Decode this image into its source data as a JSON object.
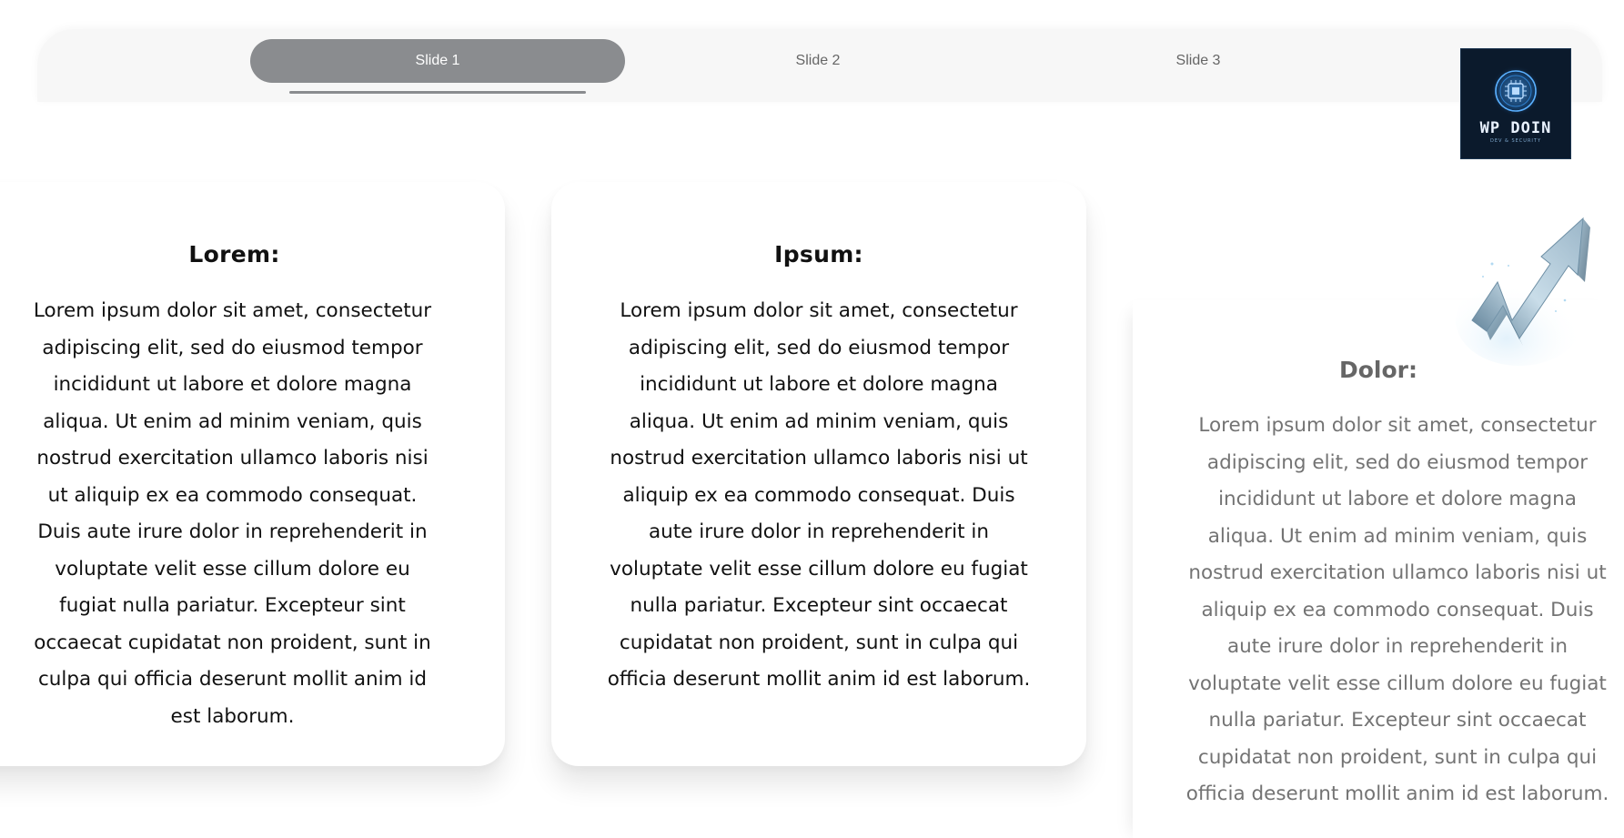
{
  "tabs": [
    {
      "label": "Slide 1",
      "active": true
    },
    {
      "label": "Slide 2",
      "active": false
    },
    {
      "label": "Slide 3",
      "active": false
    }
  ],
  "logo": {
    "text": "WP DOIN",
    "sub": "DEV & SECURITY"
  },
  "cards": [
    {
      "title": "Lorem:",
      "body": "Lorem ipsum dolor sit amet, consectetur adipiscing elit, sed do eiusmod tempor incididunt ut labore et dolore magna aliqua. Ut enim ad minim veniam, quis nostrud exercitation ullamco laboris nisi ut aliquip ex ea commodo consequat. Duis aute irure dolor in reprehenderit in voluptate velit esse cillum dolore eu fugiat nulla pariatur. Excepteur sint occaecat cupidatat non proident, sunt in culpa qui officia deserunt mollit anim id est laborum."
    },
    {
      "title": "Ipsum:",
      "body": "Lorem ipsum dolor sit amet, consectetur adipiscing elit, sed do eiusmod tempor incididunt ut labore et dolore magna aliqua. Ut enim ad minim veniam, quis nostrud exercitation ullamco laboris nisi ut aliquip ex ea commodo consequat. Duis aute irure dolor in reprehenderit in voluptate velit esse cillum dolore eu fugiat nulla pariatur. Excepteur sint occaecat cupidatat non proident, sunt in culpa qui officia deserunt mollit anim id est laborum."
    },
    {
      "title": "Dolor:",
      "body": "Lorem ipsum dolor sit amet, consectetur adipiscing elit, sed do eiusmod tempor incididunt ut labore et dolore magna aliqua. Ut enim ad minim veniam, quis nostrud exercitation ullamco laboris nisi ut aliquip ex ea commodo consequat. Duis aute irure dolor in reprehenderit in voluptate velit esse cillum dolore eu fugiat nulla pariatur. Excepteur sint occaecat cupidatat non proident, sunt in culpa qui officia deserunt mollit anim id est laborum."
    }
  ],
  "colors": {
    "tab_active_bg": "#8a8c8f",
    "tab_text": "#666666",
    "tabbar_bg": "#f7f7f7",
    "card_text": "#111111",
    "faded_text": "#737373",
    "logo_bg": "#0b1a2c"
  },
  "icons": {
    "logo": "chip-emblem-icon",
    "decoration": "rising-arrow-icon"
  }
}
